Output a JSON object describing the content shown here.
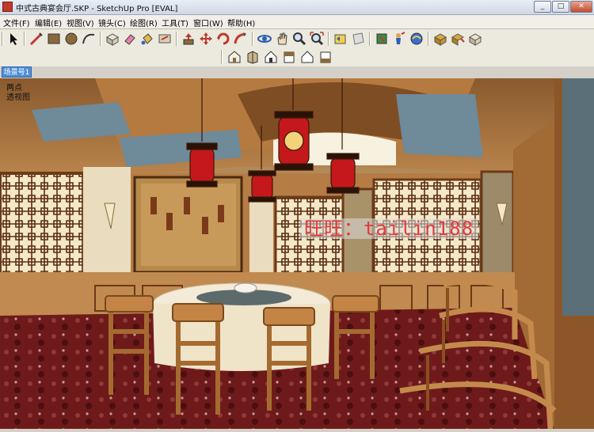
{
  "window": {
    "title": "中式古典宴会厅.SKP - SketchUp Pro [EVAL]",
    "min": "_",
    "max": "□",
    "close": "✕"
  },
  "menu": [
    "文件(F)",
    "编辑(E)",
    "视图(V)",
    "镜头(C)",
    "绘图(R)",
    "工具(T)",
    "窗口(W)",
    "帮助(H)"
  ],
  "toolbar1": [
    "select-tool-icon",
    "line-tool-icon",
    "rectangle-tool-icon",
    "circle-tool-icon",
    "arc-tool-icon",
    "make-component-icon",
    "eraser-icon",
    "paint-bucket-icon",
    "offset-icon",
    "push-pull-icon",
    "move-icon",
    "rotate-icon",
    "follow-me-icon",
    "orbit-icon",
    "pan-icon",
    "zoom-icon",
    "zoom-extents-icon",
    "previous-view-icon",
    "next-view-icon",
    "tape-measure-icon",
    "position-camera-icon",
    "walk-icon",
    "look-around-icon",
    "get-models-icon",
    "share-model-icon",
    "component-browser-icon"
  ],
  "toolbar2": [
    "iso-view-icon",
    "top-view-icon",
    "front-view-icon",
    "right-view-icon",
    "back-view-icon",
    "left-view-icon"
  ],
  "scene": {
    "tab": "场景号1"
  },
  "viewport": {
    "line1": "两点",
    "line2": "透视图"
  },
  "watermark": "旺旺：tailin188",
  "colors": {
    "menu_bg": "#f1efe8",
    "title_bg": "#cfd8e6",
    "scene_tab": "#4f8fd8",
    "wood": "#b67c45",
    "carpet": "#6e1a1a",
    "lantern": "#c4181c",
    "tablecloth": "#f3ead7"
  }
}
